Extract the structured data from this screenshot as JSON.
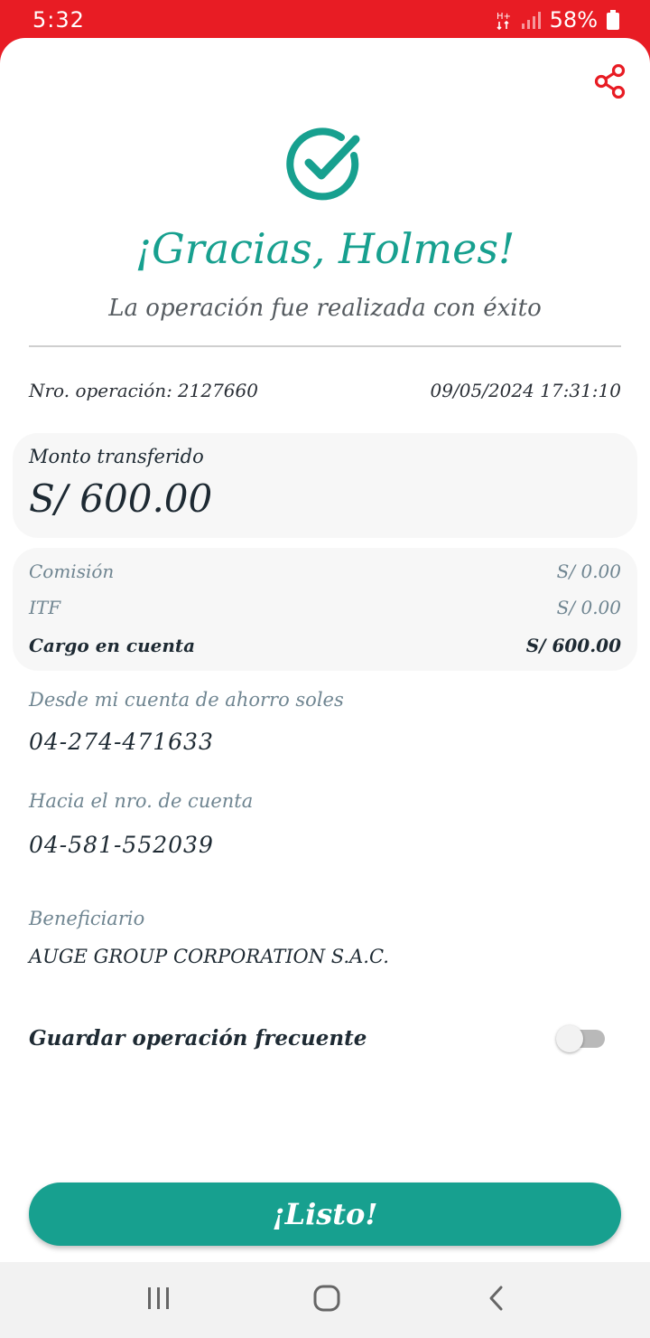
{
  "status_bar": {
    "time": "5:32",
    "battery": "58%"
  },
  "header": {
    "title": "¡Gracias, Holmes!",
    "subtitle": "La operación fue realizada con éxito"
  },
  "operation": {
    "number_label": "Nro. operación:",
    "number_value": "2127660",
    "datetime": "09/05/2024 17:31:10"
  },
  "amount_card": {
    "label": "Monto transferido",
    "value": "S/ 600.00"
  },
  "fees": [
    {
      "label": "Comisión",
      "value": "S/ 0.00"
    },
    {
      "label": "ITF",
      "value": "S/ 0.00"
    },
    {
      "label": "Cargo en cuenta",
      "value": "S/ 600.00"
    }
  ],
  "origin": {
    "label": "Desde mi cuenta de ahorro soles",
    "value": "04-274-471633"
  },
  "destination": {
    "label": "Hacia el nro. de cuenta",
    "value": "04-581-552039"
  },
  "beneficiary": {
    "label": "Beneficiario",
    "value": "AUGE GROUP CORPORATION S.A.C."
  },
  "save_frequent": {
    "label": "Guardar operación frecuente",
    "enabled": false
  },
  "done_button": {
    "label": "¡Listo!"
  },
  "icons": {
    "share": "share-icon",
    "success": "check-circle-icon",
    "nav_recents": "recents-icon",
    "nav_home": "home-icon",
    "nav_back": "back-icon"
  },
  "colors": {
    "brand_red": "#e81c24",
    "accent_teal": "#17a08f",
    "text_dark": "#1e2a33",
    "text_muted": "#6f8591"
  }
}
